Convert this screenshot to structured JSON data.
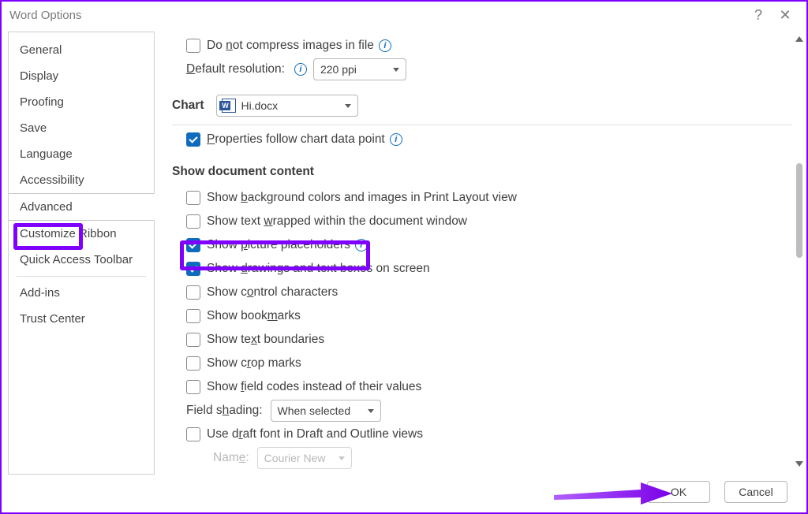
{
  "window": {
    "title": "Word Options"
  },
  "sidebar": {
    "items": [
      {
        "label": "General"
      },
      {
        "label": "Display"
      },
      {
        "label": "Proofing"
      },
      {
        "label": "Save"
      },
      {
        "label": "Language"
      },
      {
        "label": "Accessibility"
      },
      {
        "label": "Advanced"
      },
      {
        "label": "Customize Ribbon"
      },
      {
        "label": "Quick Access Toolbar"
      },
      {
        "label": "Add-ins"
      },
      {
        "label": "Trust Center"
      }
    ],
    "selected_index": 6
  },
  "main": {
    "top": {
      "compress_label_pre": "Do ",
      "compress_u": "n",
      "compress_label_post": "ot compress images in file",
      "resolution_u": "D",
      "resolution_label": "efault resolution:",
      "resolution_value": "220 ppi"
    },
    "chart_section": {
      "heading": "Chart",
      "file": "Hi.docx",
      "prop_u": "P",
      "prop_label": "roperties follow chart data point"
    },
    "content_section": {
      "heading": "Show document content",
      "items": [
        {
          "checked": false,
          "pre": "Show ",
          "u": "b",
          "post": "ackground colors and images in Print Layout view"
        },
        {
          "checked": false,
          "pre": "Show text ",
          "u": "w",
          "post": "rapped within the document window"
        },
        {
          "checked": true,
          "pre": "Show ",
          "u": "p",
          "post": "icture placeholders",
          "info": true
        },
        {
          "checked": true,
          "pre": "Show ",
          "u": "d",
          "post": "rawings and text boxes on screen"
        },
        {
          "checked": false,
          "pre": "Show c",
          "u": "o",
          "post": "ntrol characters"
        },
        {
          "checked": false,
          "pre": "Show book",
          "u": "m",
          "post": "arks"
        },
        {
          "checked": false,
          "pre": "Show te",
          "u": "x",
          "post": "t boundaries"
        },
        {
          "checked": false,
          "pre": "Show c",
          "u": "r",
          "post": "op marks"
        },
        {
          "checked": false,
          "pre": "Show ",
          "u": "f",
          "post": "ield codes instead of their values"
        }
      ],
      "field_shading_label_u": "h",
      "field_shading_label_pre": "Field s",
      "field_shading_label_post": "ading:",
      "field_shading_value": "When selected",
      "draft_font_pre": "Use d",
      "draft_font_u": "r",
      "draft_font_post": "aft font in Draft and Outline views",
      "font_name_u": "e",
      "font_name_label_pre": "Nam",
      "font_name_label_post": ":",
      "font_name_value": "Courier New"
    }
  },
  "footer": {
    "ok": "OK",
    "cancel": "Cancel"
  }
}
